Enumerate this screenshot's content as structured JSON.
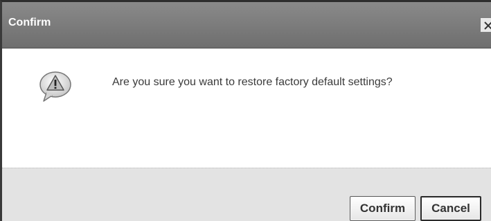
{
  "dialog": {
    "title": "Confirm",
    "close_label": "×",
    "icon": "warning-speech-bubble-icon",
    "message": "Are you sure you want to restore factory default settings?",
    "buttons": {
      "confirm_label": "Confirm",
      "cancel_label": "Cancel"
    }
  }
}
